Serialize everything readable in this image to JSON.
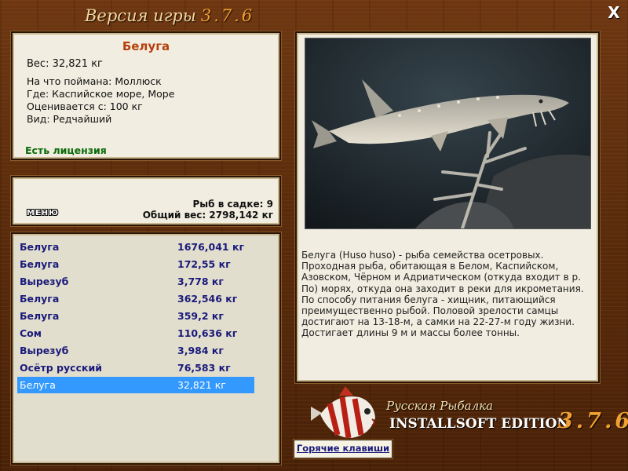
{
  "header": {
    "title": "Версия игры",
    "version": "3.7.6",
    "close_label": "X"
  },
  "fish": {
    "name": "Белуга",
    "weight": "Вес: 32,821 кг",
    "lines": [
      "На что поймана: Моллюск",
      "Где: Каспийское море, Море",
      "Оценивается с: 100 кг",
      "Вид: Редчайший"
    ],
    "license": "Есть лицензия"
  },
  "keepnet": {
    "menu_label": "МЕНЮ",
    "count": "Рыб в садке: 9",
    "total": "Общий вес: 2798,142 кг"
  },
  "catch_list": [
    {
      "name": "Белуга",
      "weight": "1676,041 кг"
    },
    {
      "name": "Белуга",
      "weight": "172,55 кг"
    },
    {
      "name": "Вырезуб",
      "weight": "3,778 кг"
    },
    {
      "name": "Белуга",
      "weight": "362,546 кг"
    },
    {
      "name": "Белуга",
      "weight": "359,2 кг"
    },
    {
      "name": "Сом",
      "weight": "110,636 кг"
    },
    {
      "name": "Вырезуб",
      "weight": "3,984 кг"
    },
    {
      "name": "Осётр русский",
      "weight": "76,583 кг"
    },
    {
      "name": "Белуга",
      "weight": "32,821 кг"
    }
  ],
  "description": "Белуга (Huso huso) - рыба семейства осетровых. Проходная рыба, обитающая в Белом, Каспийском, Азовском, Чёрном и Адриатическом (откуда входит в р. По) морях, откуда она заходит в реки для икрометания. По способу питания белуга - хищник, питающийся преимущественно рыбой. Половой зрелости самцы достигают на 13-18-м, а самки на 22-27-м году жизни. Достигает длины 9 м и массы более тонны.",
  "branding": {
    "line1": "Русская Рыбалка",
    "line2": "INSTALLSOFT EDITION",
    "version": "3.7.6"
  },
  "hotkeys_label": "Горячие клавиши",
  "colors": {
    "wood": "#5b2c0c",
    "panel": "#f1ede0",
    "list_text": "#1a1a7a",
    "selection": "#3399ff",
    "fish_name": "#b5400e",
    "license": "#0a6b0a",
    "accent_version": "#f0a030"
  }
}
